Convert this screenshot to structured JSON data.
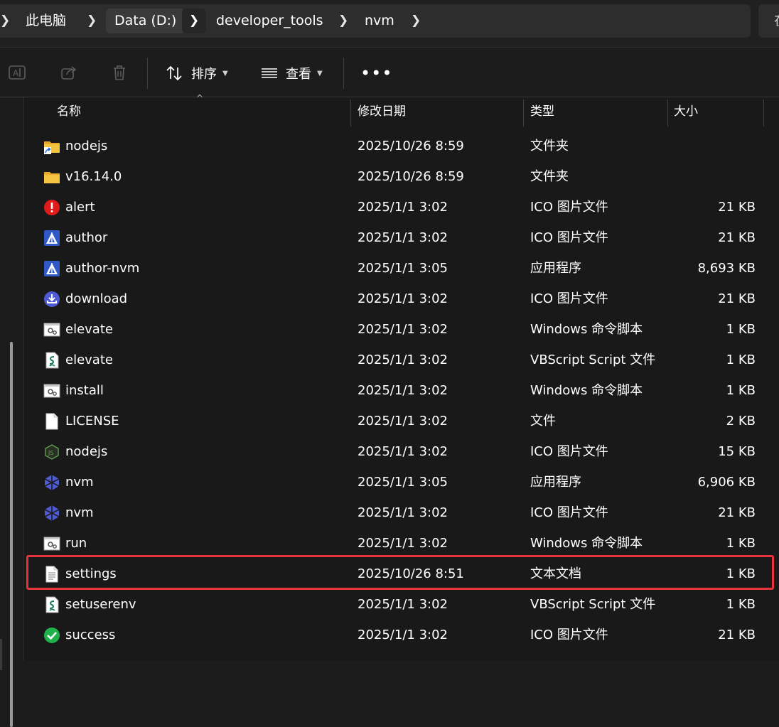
{
  "breadcrumb": {
    "items": [
      "此电脑",
      "Data (D:)",
      "developer_tools",
      "nvm"
    ],
    "search_stub": "在"
  },
  "toolbar": {
    "sort_label": "排序",
    "view_label": "查看",
    "more_label": "•••",
    "icons": [
      "rename-icon",
      "share-icon",
      "delete-icon",
      "sort-icon",
      "view-icon",
      "more-icon"
    ]
  },
  "columns": {
    "name": "名称",
    "date": "修改日期",
    "type": "类型",
    "size": "大小"
  },
  "files": [
    {
      "name": "nodejs",
      "date": "2025/10/26 8:59",
      "type": "文件夹",
      "size": "",
      "icon": "folder-shortcut-icon"
    },
    {
      "name": "v16.14.0",
      "date": "2025/10/26 8:59",
      "type": "文件夹",
      "size": "",
      "icon": "folder-icon"
    },
    {
      "name": "alert",
      "date": "2025/1/1 3:02",
      "type": "ICO 图片文件",
      "size": "21 KB",
      "icon": "alert-icon"
    },
    {
      "name": "author",
      "date": "2025/1/1 3:02",
      "type": "ICO 图片文件",
      "size": "21 KB",
      "icon": "author-icon"
    },
    {
      "name": "author-nvm",
      "date": "2025/1/1 3:05",
      "type": "应用程序",
      "size": "8,693 KB",
      "icon": "author-icon"
    },
    {
      "name": "download",
      "date": "2025/1/1 3:02",
      "type": "ICO 图片文件",
      "size": "21 KB",
      "icon": "download-icon"
    },
    {
      "name": "elevate",
      "date": "2025/1/1 3:02",
      "type": "Windows 命令脚本",
      "size": "1 KB",
      "icon": "cmd-script-icon"
    },
    {
      "name": "elevate",
      "date": "2025/1/1 3:02",
      "type": "VBScript Script 文件",
      "size": "1 KB",
      "icon": "vbscript-icon"
    },
    {
      "name": "install",
      "date": "2025/1/1 3:02",
      "type": "Windows 命令脚本",
      "size": "1 KB",
      "icon": "cmd-script-icon"
    },
    {
      "name": "LICENSE",
      "date": "2025/1/1 3:02",
      "type": "文件",
      "size": "2 KB",
      "icon": "blank-file-icon"
    },
    {
      "name": "nodejs",
      "date": "2025/1/1 3:02",
      "type": "ICO 图片文件",
      "size": "15 KB",
      "icon": "nodejs-icon"
    },
    {
      "name": "nvm",
      "date": "2025/1/1 3:05",
      "type": "应用程序",
      "size": "6,906 KB",
      "icon": "nvm-icon"
    },
    {
      "name": "nvm",
      "date": "2025/1/1 3:02",
      "type": "ICO 图片文件",
      "size": "21 KB",
      "icon": "nvm-icon"
    },
    {
      "name": "run",
      "date": "2025/1/1 3:02",
      "type": "Windows 命令脚本",
      "size": "1 KB",
      "icon": "cmd-script-icon"
    },
    {
      "name": "settings",
      "date": "2025/10/26 8:51",
      "type": "文本文档",
      "size": "1 KB",
      "icon": "text-file-icon",
      "highlighted": true
    },
    {
      "name": "setuserenv",
      "date": "2025/1/1 3:02",
      "type": "VBScript Script 文件",
      "size": "1 KB",
      "icon": "vbscript-icon"
    },
    {
      "name": "success",
      "date": "2025/1/1 3:02",
      "type": "ICO 图片文件",
      "size": "21 KB",
      "icon": "success-icon"
    }
  ],
  "colors": {
    "highlight_border": "#e8323c",
    "folder": "#f5c542",
    "nvm": "#4f5bd5",
    "alert": "#e01b1b",
    "success": "#1fb24a"
  }
}
